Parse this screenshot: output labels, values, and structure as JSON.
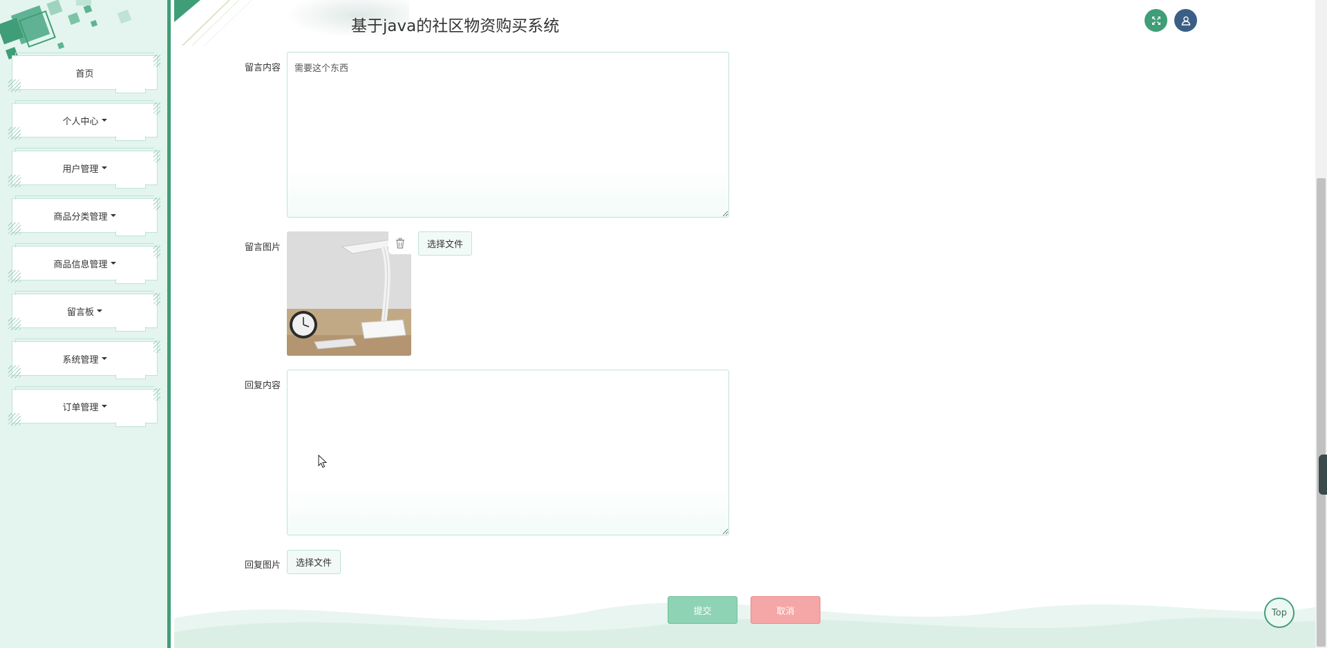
{
  "app": {
    "title": "基于java的社区物资购买系统"
  },
  "header": {
    "fullscreen_icon": "expand-arrows-icon",
    "user_icon": "user-icon"
  },
  "sidebar": {
    "items": [
      {
        "label": "首页",
        "has_caret": false
      },
      {
        "label": "个人中心",
        "has_caret": true
      },
      {
        "label": "用户管理",
        "has_caret": true
      },
      {
        "label": "商品分类管理",
        "has_caret": true
      },
      {
        "label": "商品信息管理",
        "has_caret": true
      },
      {
        "label": "留言板",
        "has_caret": true
      },
      {
        "label": "系统管理",
        "has_caret": true
      },
      {
        "label": "订单管理",
        "has_caret": true
      }
    ]
  },
  "form": {
    "message_content": {
      "label": "留言内容",
      "value": "需要这个东西"
    },
    "message_image": {
      "label": "留言图片",
      "file_button": "选择文件",
      "delete_icon": "trash-icon"
    },
    "reply_content": {
      "label": "回复内容",
      "value": ""
    },
    "reply_image": {
      "label": "回复图片",
      "file_button": "选择文件"
    }
  },
  "actions": {
    "submit": "提交",
    "cancel": "取消"
  },
  "back_to_top": "Top",
  "colors": {
    "primary": "#3f9d77",
    "sidebar_bg": "#e3f5ee",
    "submit_bg": "#8ed3b4",
    "cancel_bg": "#f5a6a6",
    "user_btn": "#3a5e86"
  }
}
